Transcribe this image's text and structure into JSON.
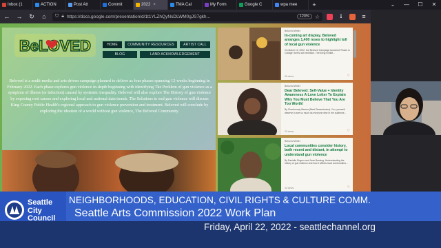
{
  "browser": {
    "tabs": [
      {
        "label": "Inbox (1",
        "color": "#d44638"
      },
      {
        "label": "ACTION",
        "color": "#2c8be8"
      },
      {
        "label": "Post Att",
        "color": "#5a9bf0"
      },
      {
        "label": "Commit",
        "color": "#1e6fd9"
      },
      {
        "label": "2022",
        "color": "#f4b400"
      },
      {
        "label": "TMA Cal",
        "color": "#2c8be8"
      },
      {
        "label": "My Form",
        "color": "#7a3fc1"
      },
      {
        "label": "Google C",
        "color": "#0f9d58"
      },
      {
        "label": "wpa mee",
        "color": "#4285f4"
      }
    ],
    "url": "https://docs.google.com/presentation/d/1t1YLZhQyNsDLWM0gJS7gkh...",
    "zoom": "120%",
    "new_tab": "+"
  },
  "site": {
    "logo_text": "BeLOVED",
    "nav": {
      "home": "HOME",
      "community_resources": "COMMUNITY RESOURCES",
      "artist_call": "ARTIST CALL",
      "blog": "BLOG",
      "land_acknowledgement": "LAND ACKNOWLEDGEMENT"
    },
    "intro": "Beloved is a multi-media and arts driven campaign planned to deliver as four phases spanning 12-weeks beginning in February 2022. Each phase explores gun violence in-depth beginning with identifying The Problem of gun violence as a symptom of illness (or infection) caused by systemic inequality. Beloved will also explore The History of gun violence by exposing root causes and exploring local and national data trends. The Solutions to end gun violence will discuss King County Public Health's regional approach to gun violence prevention and treatment. Beloved will conclude by exploring the ideation of a world without gun violence, The Beloved Community."
  },
  "posts": [
    {
      "meta": "Beloved Writer",
      "title": "In-coming art display. Beloved arranges 1,400 roses to highlight toll of local gun violence",
      "body": "On March 10, 2022, the Beloved Campaign launched 'Roses in Collage' its first art exhibition. The living exhibit...",
      "foot": "56 views",
      "img_colors": [
        "#d8c0a0",
        "#6a4a32",
        "#e8a84a"
      ]
    },
    {
      "meta": "Beloved Writer",
      "title": "Dear Beloved: Self-Value + Identity Awareness A Love Letter To Explain Why You Must Believe That You Are Too Worth!",
      "body": "By Chardonnay Beaver (Beat Disseminator). You, yourself, deserve to see so much as everyone else in the audience...",
      "foot": "20 views",
      "img_colors": [
        "#e8e2d8",
        "#3a2a22",
        "#2e2a28"
      ]
    },
    {
      "meta": "Beloved Writer",
      "title": "Local communities consider history, both recent and distant, in attempt to understand gun violence",
      "body": "By Danielle Rogers and Jean Bussing. Understanding the history of gun violence and how it affects local communities...",
      "foot": "44 views",
      "img_colors": [
        "#3f7a36",
        "#e0d8c8",
        "#6a4a32"
      ]
    }
  ],
  "banner": {
    "council_line1": "Seattle",
    "council_line2": "City",
    "council_line3": "Council",
    "committee": "NEIGHBORHOODS, EDUCATION, CIVIL RIGHTS & CULTURE COMM.",
    "subject": "Seattle Arts Commission 2022 Work Plan",
    "dateline": "Friday, April 22, 2022 - seattlechannel.org"
  },
  "colors": {
    "banner_blue": "#2a55c0",
    "banner_dark": "#1c356f",
    "nav_green": "#0d3b36",
    "post_title_green": "#0f7a3c"
  }
}
